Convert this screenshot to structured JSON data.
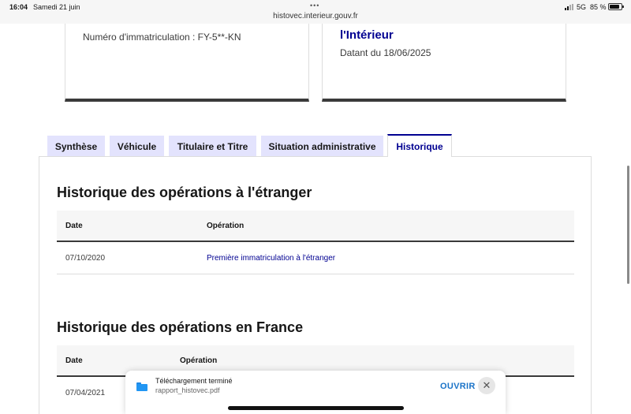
{
  "status_bar": {
    "time": "16:04",
    "date": "Samedi 21 juin",
    "url": "histovec.interieur.gouv.fr",
    "network": "5G",
    "battery": "85 %"
  },
  "cards": {
    "plate": "Numéro d'immatriculation : FY-5**-KN",
    "source": "l'Intérieur",
    "dated": "Datant du 18/06/2025"
  },
  "tabs": [
    {
      "label": "Synthèse"
    },
    {
      "label": "Véhicule"
    },
    {
      "label": "Titulaire et Titre"
    },
    {
      "label": "Situation administrative"
    },
    {
      "label": "Historique"
    }
  ],
  "abroad": {
    "title": "Historique des opérations à l'étranger",
    "col_date": "Date",
    "col_operation": "Opération",
    "rows": [
      {
        "date": "07/10/2020",
        "operation": "Première immatriculation à l'étranger"
      }
    ]
  },
  "france": {
    "title": "Historique des opérations en France",
    "col_date": "Date",
    "col_operation": "Opération",
    "rows": [
      {
        "date": "07/04/2021"
      }
    ]
  },
  "download": {
    "title": "Téléchargement terminé",
    "file": "rapport_histovec.pdf",
    "open_label": "OUVRIR",
    "close_symbol": "✕"
  },
  "colors": {
    "accent": "#000091",
    "tab_bg": "#e3e3fd",
    "open_link": "#1a73c8"
  }
}
